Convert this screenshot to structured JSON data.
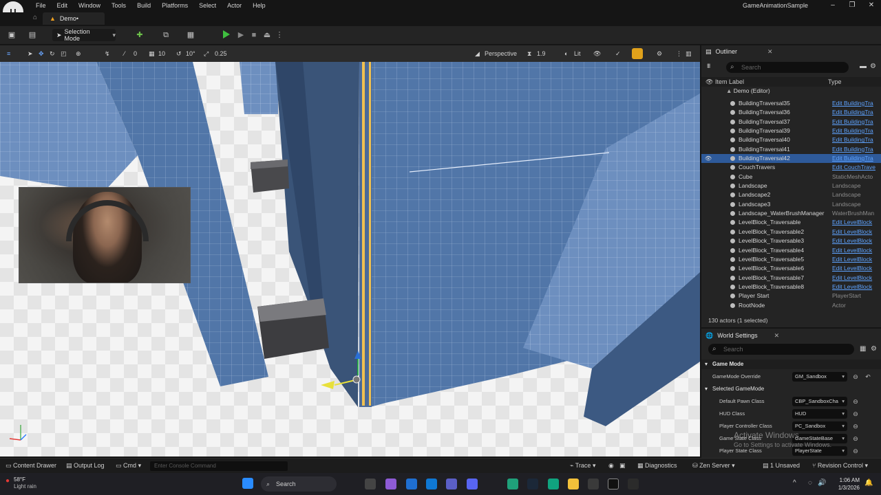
{
  "window": {
    "menu": [
      "File",
      "Edit",
      "Window",
      "Tools",
      "Build",
      "Platforms",
      "Select",
      "Actor",
      "Help"
    ],
    "project_title": "GameAnimationSample",
    "level_tab": "Demo•"
  },
  "toolbar": {
    "selection_mode": "Selection Mode"
  },
  "viewport_toolbar": {
    "rotation_snap": "10°",
    "grid_snap": "10",
    "angle_snap": "10°",
    "scale_snap": "0.25",
    "view_mode": "Perspective",
    "camera_speed": "1.9",
    "lighting": "Lit",
    "grid_value": "0"
  },
  "outliner": {
    "tab": "Outliner",
    "search_placeholder": "Search",
    "col_label": "Item Label",
    "col_type": "Type",
    "root": "Demo (Editor)",
    "rows": [
      {
        "name": "BuildingTraversal35",
        "type": "Edit BuildingTra",
        "link": true
      },
      {
        "name": "BuildingTraversal36",
        "type": "Edit BuildingTra",
        "link": true
      },
      {
        "name": "BuildingTraversal37",
        "type": "Edit BuildingTra",
        "link": true
      },
      {
        "name": "BuildingTraversal39",
        "type": "Edit BuildingTra",
        "link": true
      },
      {
        "name": "BuildingTraversal40",
        "type": "Edit BuildingTra",
        "link": true
      },
      {
        "name": "BuildingTraversal41",
        "type": "Edit BuildingTra",
        "link": true
      },
      {
        "name": "BuildingTraversal42",
        "type": "Edit BuildingTra",
        "link": true,
        "selected": true
      },
      {
        "name": "CouchTravers",
        "type": "Edit CouchTrave",
        "link": true
      },
      {
        "name": "Cube",
        "type": "StaticMeshActo",
        "link": false
      },
      {
        "name": "Landscape",
        "type": "Landscape",
        "link": false
      },
      {
        "name": "Landscape2",
        "type": "Landscape",
        "link": false
      },
      {
        "name": "Landscape3",
        "type": "Landscape",
        "link": false
      },
      {
        "name": "Landscape_WaterBrushManager",
        "type": "WaterBrushMan",
        "link": false
      },
      {
        "name": "LevelBlock_Traversable",
        "type": "Edit LevelBlock",
        "link": true
      },
      {
        "name": "LevelBlock_Traversable2",
        "type": "Edit LevelBlock",
        "link": true
      },
      {
        "name": "LevelBlock_Traversable3",
        "type": "Edit LevelBlock",
        "link": true
      },
      {
        "name": "LevelBlock_Traversable4",
        "type": "Edit LevelBlock",
        "link": true
      },
      {
        "name": "LevelBlock_Traversable5",
        "type": "Edit LevelBlock",
        "link": true
      },
      {
        "name": "LevelBlock_Traversable6",
        "type": "Edit LevelBlock",
        "link": true
      },
      {
        "name": "LevelBlock_Traversable7",
        "type": "Edit LevelBlock",
        "link": true
      },
      {
        "name": "LevelBlock_Traversable8",
        "type": "Edit LevelBlock",
        "link": true
      },
      {
        "name": "Player Start",
        "type": "PlayerStart",
        "link": false
      },
      {
        "name": "RootNode",
        "type": "Actor",
        "link": false
      }
    ],
    "actor_count": "130 actors (1 selected)"
  },
  "world_settings": {
    "tab": "World Settings",
    "search_placeholder": "Search",
    "category_game_mode": "Game Mode",
    "game_mode_override_label": "GameMode Override",
    "game_mode_override_value": "GM_Sandbox",
    "category_selected": "Selected GameMode",
    "props": [
      {
        "label": "Default Pawn Class",
        "value": "CBP_SandboxCha"
      },
      {
        "label": "HUD Class",
        "value": "HUD"
      },
      {
        "label": "Player Controller Class",
        "value": "PC_Sandbox"
      },
      {
        "label": "Game State Class",
        "value": "GameStateBase"
      },
      {
        "label": "Player State Class",
        "value": "PlayerState"
      }
    ]
  },
  "watermark": {
    "line1": "Activate Windows",
    "line2": "Go to Settings to activate Windows."
  },
  "bottombar": {
    "content_drawer": "Content Drawer",
    "output_log": "Output Log",
    "cmd": "Cmd",
    "console_placeholder": "Enter Console Command",
    "trace": "Trace",
    "diagnostics": "Diagnostics",
    "zen_server": "Zen Server",
    "unsaved": "1 Unsaved",
    "revision_control": "Revision Control"
  },
  "taskbar": {
    "temperature": "58°F",
    "weather": "Light rain",
    "search": "Search",
    "time": "1:06 AM",
    "date": "1/3/2026"
  }
}
